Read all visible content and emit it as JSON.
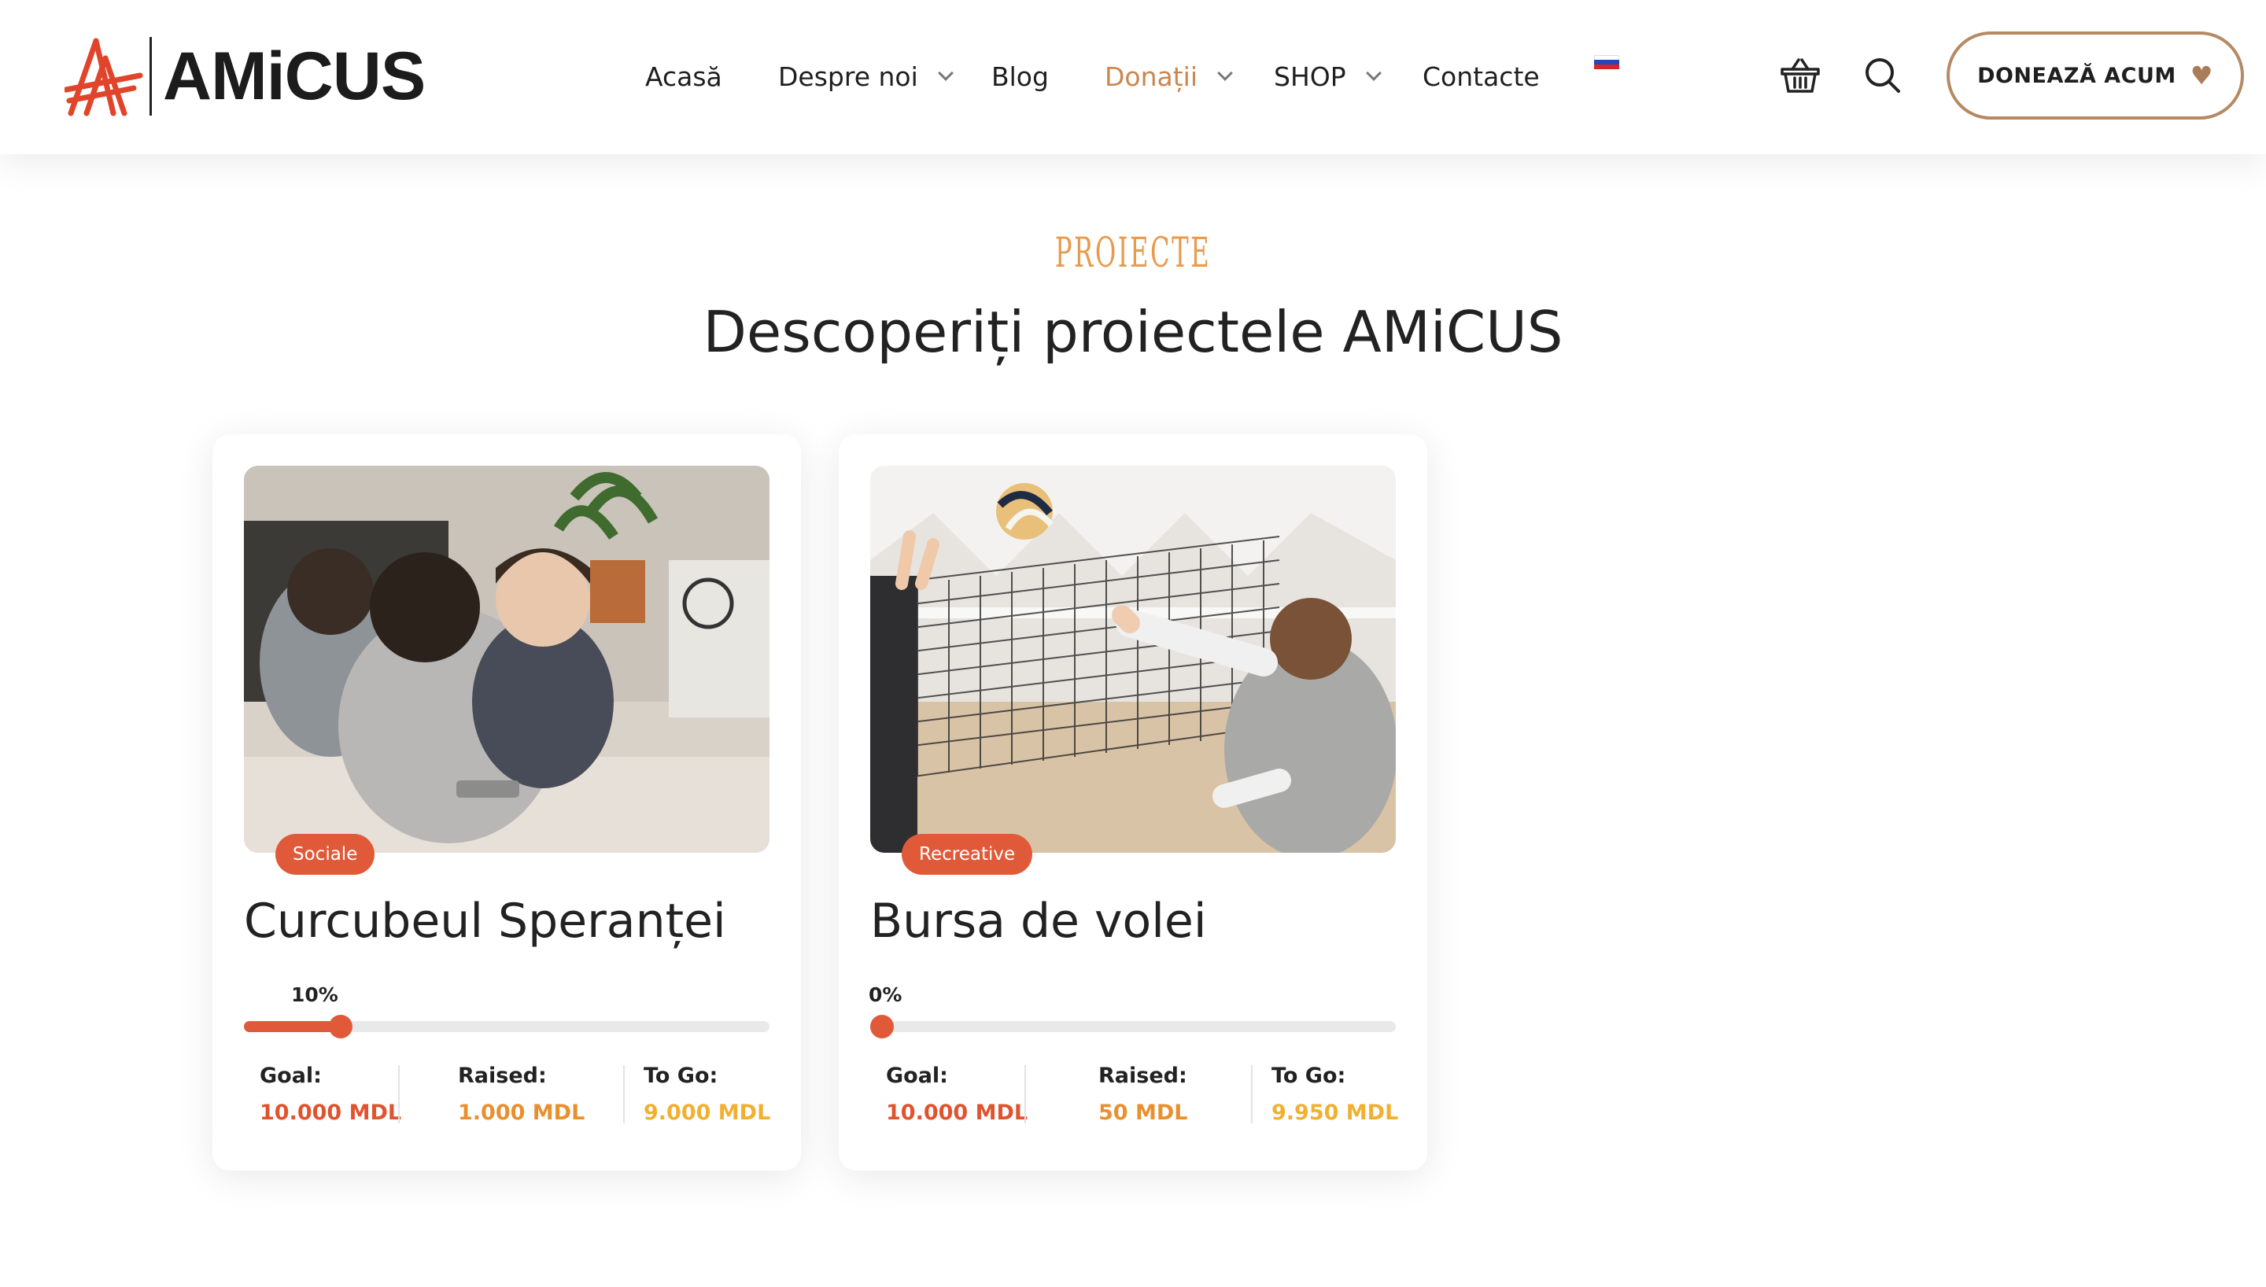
{
  "brand": {
    "name": "AMiCUS",
    "accent": "#e05a3a",
    "gold": "#c9874f"
  },
  "nav": {
    "items": [
      {
        "label": "Acasă",
        "has_dropdown": false,
        "active": false
      },
      {
        "label": "Despre noi",
        "has_dropdown": true,
        "active": false
      },
      {
        "label": "Blog",
        "has_dropdown": false,
        "active": false
      },
      {
        "label": "Donații",
        "has_dropdown": true,
        "active": true
      },
      {
        "label": "SHOP",
        "has_dropdown": true,
        "active": false
      },
      {
        "label": "Contacte",
        "has_dropdown": false,
        "active": false
      }
    ],
    "language_icon": "russian-flag-icon",
    "cart_icon": "basket-icon",
    "search_icon": "search-icon",
    "donate_label": "DONEAZĂ ACUM",
    "donate_icon": "heart-icon"
  },
  "section": {
    "eyebrow": "PROIECTE",
    "title": "Descoperiți proiectele AMiCUS"
  },
  "projects": [
    {
      "category": "Sociale",
      "title": "Curcubeul Speranței",
      "progress_percent": 10,
      "progress_label": "10%",
      "goal_label": "Goal:",
      "goal_value": "10.000 MDL",
      "raised_label": "Raised:",
      "raised_value": "1.000 MDL",
      "togo_label": "To Go:",
      "togo_value": "9.000 MDL",
      "image": "photo of children hugging a woman at a table"
    },
    {
      "category": "Recreative",
      "title": "Bursa de volei",
      "progress_percent": 0,
      "progress_label": "0%",
      "goal_label": "Goal:",
      "goal_value": "10.000 MDL",
      "raised_label": "Raised:",
      "raised_value": "50 MDL",
      "togo_label": "To Go:",
      "togo_value": "9.950 MDL",
      "image": "photo of girls playing volleyball at the net"
    }
  ]
}
